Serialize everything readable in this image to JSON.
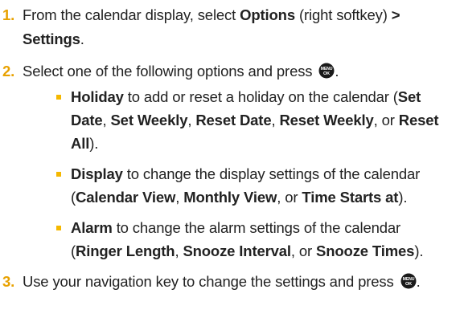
{
  "colors": {
    "step_number": "#e8a100",
    "bullet": "#f5b800",
    "text": "#222222",
    "menu_key": "#1a1a1a"
  },
  "steps": [
    {
      "number": "1.",
      "segments": [
        {
          "text": "From the calendar display, select ",
          "bold": false
        },
        {
          "text": "Options",
          "bold": true
        },
        {
          "text": " (right softkey) ",
          "bold": false
        },
        {
          "text": "> Settings",
          "bold": true
        },
        {
          "text": ".",
          "bold": false
        }
      ]
    },
    {
      "number": "2.",
      "segments": [
        {
          "text": "Select one of the following options and press ",
          "bold": false
        }
      ],
      "trailing": ".",
      "menu_key": {
        "icon": "menu-ok-key-icon",
        "top": "MENU",
        "bottom": "OK"
      },
      "sub_items": [
        {
          "segments": [
            {
              "text": "Holiday",
              "bold": true
            },
            {
              "text": " to add or reset a holiday on the calendar (",
              "bold": false
            },
            {
              "text": "Set Date",
              "bold": true
            },
            {
              "text": ", ",
              "bold": false
            },
            {
              "text": "Set Weekly",
              "bold": true
            },
            {
              "text": ", ",
              "bold": false
            },
            {
              "text": "Reset Date",
              "bold": true
            },
            {
              "text": ", ",
              "bold": false
            },
            {
              "text": "Reset Weekly",
              "bold": true
            },
            {
              "text": ", or ",
              "bold": false
            },
            {
              "text": "Reset All",
              "bold": true
            },
            {
              "text": ").",
              "bold": false
            }
          ]
        },
        {
          "segments": [
            {
              "text": "Display",
              "bold": true
            },
            {
              "text": " to change the display settings of the calendar (",
              "bold": false
            },
            {
              "text": "Calendar View",
              "bold": true
            },
            {
              "text": ", ",
              "bold": false
            },
            {
              "text": "Monthly View",
              "bold": true
            },
            {
              "text": ", or ",
              "bold": false
            },
            {
              "text": "Time Starts at",
              "bold": true
            },
            {
              "text": ").",
              "bold": false
            }
          ]
        },
        {
          "segments": [
            {
              "text": "Alarm",
              "bold": true
            },
            {
              "text": " to change the alarm settings of the calendar (",
              "bold": false
            },
            {
              "text": "Ringer Length",
              "bold": true
            },
            {
              "text": ", ",
              "bold": false
            },
            {
              "text": "Snooze Interval",
              "bold": true
            },
            {
              "text": ", or ",
              "bold": false
            },
            {
              "text": "Snooze Times",
              "bold": true
            },
            {
              "text": ").",
              "bold": false
            }
          ]
        }
      ]
    },
    {
      "number": "3.",
      "segments": [
        {
          "text": "Use your navigation key to change the settings and press ",
          "bold": false
        }
      ],
      "trailing": ".",
      "menu_key": {
        "icon": "menu-ok-key-icon",
        "top": "MENU",
        "bottom": "OK"
      }
    }
  ]
}
